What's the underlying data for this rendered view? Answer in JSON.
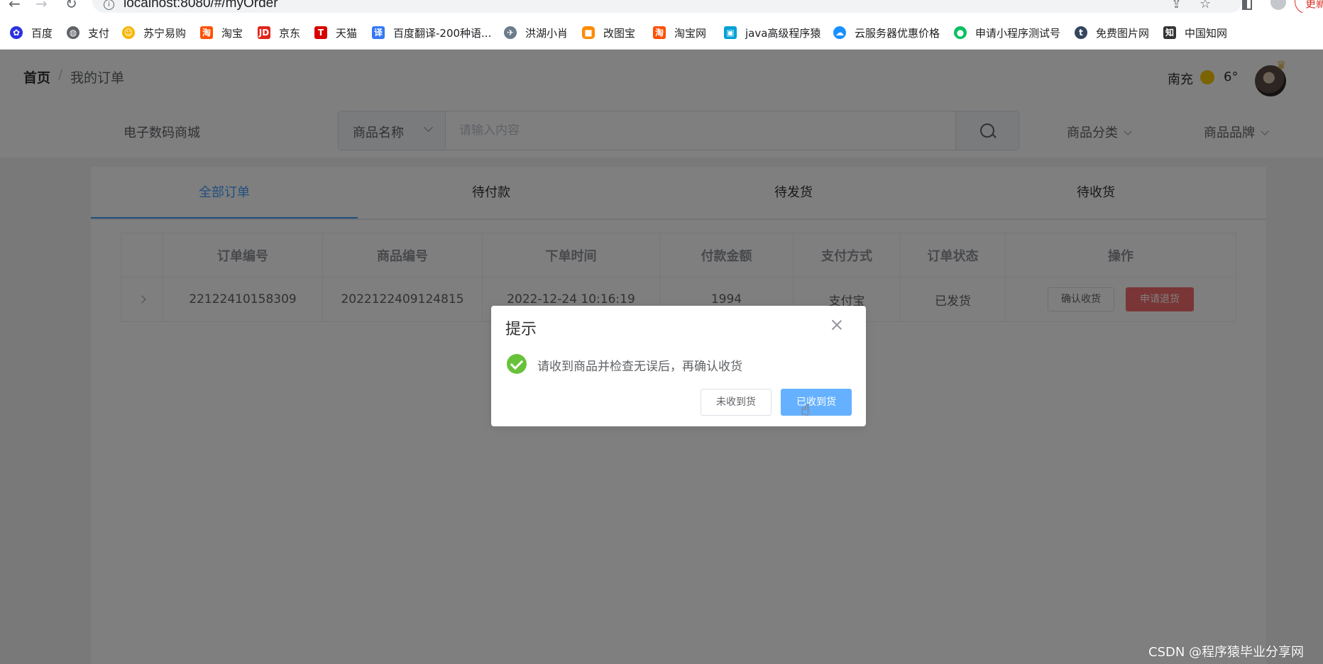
{
  "browser": {
    "url": "localhost:8080/#/myOrder",
    "update_label": "更新",
    "bookmarks": [
      {
        "label": "百度",
        "icon": "baidu-paw-icon",
        "color": "#2932e1"
      },
      {
        "label": "支付",
        "icon": "globe-icon",
        "color": "#5f6368"
      },
      {
        "label": "苏宁易购",
        "icon": "suning-lion-icon",
        "color": "#f7b500"
      },
      {
        "label": "淘宝",
        "icon": "taobao-icon",
        "color": "#ff5000"
      },
      {
        "label": "京东",
        "icon": "jd-icon",
        "color": "#e1251b"
      },
      {
        "label": "天猫",
        "icon": "tmall-icon",
        "color": "#d70000"
      },
      {
        "label": "百度翻译-200种语...",
        "icon": "translate-icon",
        "color": "#3478f6"
      },
      {
        "label": "洪湖小肖",
        "icon": "bird-icon",
        "color": "#6b7b8c"
      },
      {
        "label": "改图宝",
        "icon": "gaitubao-icon",
        "color": "#ff8a00"
      },
      {
        "label": "淘宝网",
        "icon": "taobao-icon",
        "color": "#ff5000"
      },
      {
        "label": "java高级程序猿",
        "icon": "bilibili-tv-icon",
        "color": "#00a1d6"
      },
      {
        "label": "云服务器优惠价格",
        "icon": "cloud-icon",
        "color": "#1890ff"
      },
      {
        "label": "申请小程序测试号",
        "icon": "wechat-icon",
        "color": "#07c160"
      },
      {
        "label": "免费图片网",
        "icon": "t-circle-icon",
        "color": "#34465d"
      },
      {
        "label": "中国知网",
        "icon": "cnki-icon",
        "color": "#333333"
      }
    ]
  },
  "header": {
    "breadcrumb_home": "首页",
    "breadcrumb_sep": "/",
    "breadcrumb_current": "我的订单",
    "weather_city": "南充",
    "weather_temp": "6°"
  },
  "search": {
    "shop_name": "电子数码商城",
    "field_select": "商品名称",
    "placeholder": "请输入内容",
    "category_label": "商品分类",
    "brand_label": "商品品牌"
  },
  "tabs": [
    {
      "label": "全部订单",
      "active": true
    },
    {
      "label": "待付款",
      "active": false
    },
    {
      "label": "待发货",
      "active": false
    },
    {
      "label": "待收货",
      "active": false
    }
  ],
  "table": {
    "columns": [
      "订单编号",
      "商品编号",
      "下单时间",
      "付款金额",
      "支付方式",
      "订单状态",
      "操作"
    ],
    "rows": [
      {
        "order_no": "22122410158309",
        "product_no": "2022122409124815",
        "order_time": "2022-12-24 10:16:19",
        "amount": "1994",
        "pay_method": "支付宝",
        "status": "已发货",
        "action_confirm": "确认收货",
        "action_return": "申请退货"
      }
    ]
  },
  "dialog": {
    "title": "提示",
    "message": "请收到商品并检查无误后，再确认收货",
    "cancel_label": "未收到货",
    "ok_label": "已收到货"
  },
  "watermark": "CSDN @程序猿毕业分享网",
  "colors": {
    "primary": "#409eff",
    "danger": "#f56c6c",
    "success": "#67c23a"
  }
}
